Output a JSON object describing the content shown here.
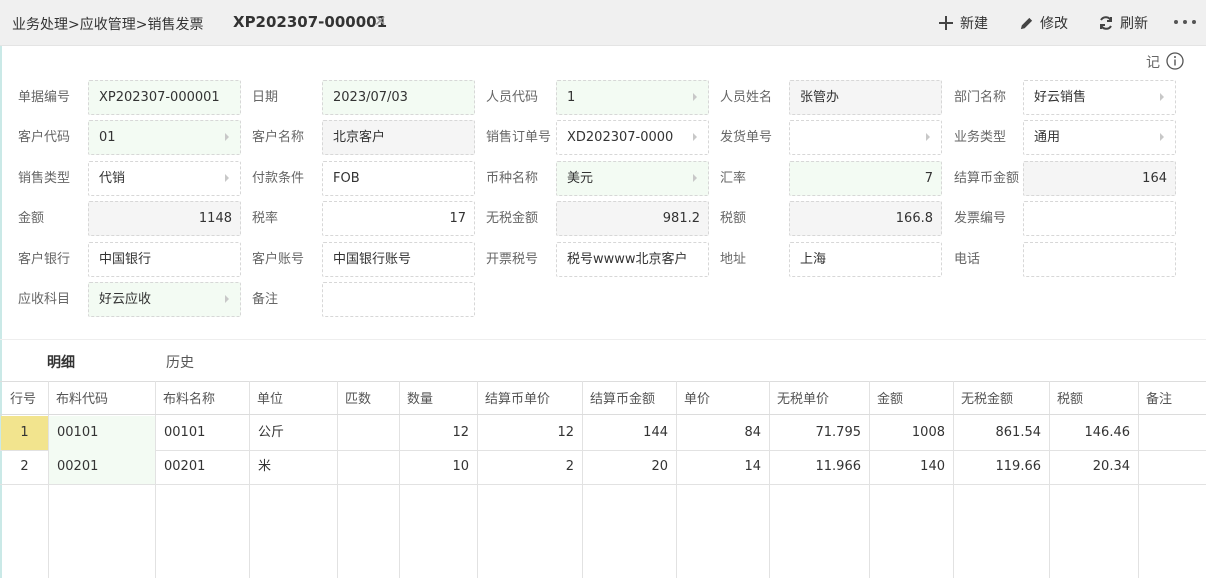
{
  "header": {
    "breadcrumb": "业务处理>应收管理>销售发票",
    "doc_tab": "XP202307-000001",
    "close_glyph": "✕",
    "actions": {
      "new": "新建",
      "edit": "修改",
      "refresh": "刷新"
    },
    "note_label": "记"
  },
  "form": {
    "doc_no_label": "单据编号",
    "doc_no": "XP202307-000001",
    "date_label": "日期",
    "date": "2023/07/03",
    "staff_code_label": "人员代码",
    "staff_code": "1",
    "staff_name_label": "人员姓名",
    "staff_name": "张管办",
    "dept_label": "部门名称",
    "dept": "好云销售",
    "cust_code_label": "客户代码",
    "cust_code": "01",
    "cust_name_label": "客户名称",
    "cust_name": "北京客户",
    "so_no_label": "销售订单号",
    "so_no": "XD202307-0000",
    "ship_no_label": "发货单号",
    "ship_no": "",
    "biz_type_label": "业务类型",
    "biz_type": "通用",
    "sale_type_label": "销售类型",
    "sale_type": "代销",
    "pay_terms_label": "付款条件",
    "pay_terms": "FOB",
    "currency_label": "币种名称",
    "currency": "美元",
    "rate_label": "汇率",
    "rate": "7",
    "settle_amt_label": "结算币金额",
    "settle_amt": "164",
    "amount_label": "金额",
    "amount": "1148",
    "tax_rate_label": "税率",
    "tax_rate": "17",
    "net_amt_label": "无税金额",
    "net_amt": "981.2",
    "tax_amt_label": "税额",
    "tax_amt": "166.8",
    "invoice_no_label": "发票编号",
    "invoice_no": "",
    "bank_label": "客户银行",
    "bank": "中国银行",
    "account_label": "客户账号",
    "account": "中国银行账号",
    "tax_id_label": "开票税号",
    "tax_id": "税号wwww北京客户",
    "address_label": "地址",
    "address": "上海",
    "phone_label": "电话",
    "phone": "",
    "ar_subject_label": "应收科目",
    "ar_subject": "好云应收",
    "remark_label": "备注",
    "remark": ""
  },
  "tabs": [
    "明细",
    "历史"
  ],
  "table": {
    "headers": [
      "行号",
      "布料代码",
      "布料名称",
      "单位",
      "匹数",
      "数量",
      "结算币单价",
      "结算币金额",
      "单价",
      "无税单价",
      "金额",
      "无税金额",
      "税额",
      "备注"
    ],
    "rows": [
      [
        "1",
        "00101",
        "00101",
        "公斤",
        "",
        "12",
        "12",
        "144",
        "84",
        "71.795",
        "1008",
        "861.54",
        "146.46",
        ""
      ],
      [
        "2",
        "00201",
        "00201",
        "米",
        "",
        "10",
        "2",
        "20",
        "14",
        "11.966",
        "140",
        "119.66",
        "20.34",
        ""
      ]
    ]
  }
}
